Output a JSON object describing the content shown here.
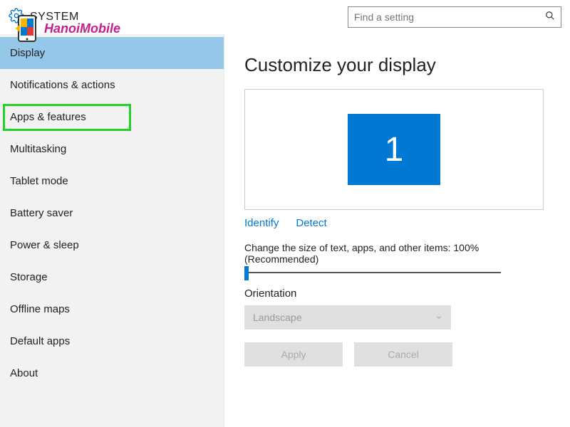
{
  "header": {
    "title": "SYSTEM",
    "search_placeholder": "Find a setting"
  },
  "sidebar": {
    "items": [
      {
        "label": "Display",
        "selected": true,
        "highlighted": false
      },
      {
        "label": "Notifications & actions",
        "selected": false,
        "highlighted": false
      },
      {
        "label": "Apps & features",
        "selected": false,
        "highlighted": true
      },
      {
        "label": "Multitasking",
        "selected": false,
        "highlighted": false
      },
      {
        "label": "Tablet mode",
        "selected": false,
        "highlighted": false
      },
      {
        "label": "Battery saver",
        "selected": false,
        "highlighted": false
      },
      {
        "label": "Power & sleep",
        "selected": false,
        "highlighted": false
      },
      {
        "label": "Storage",
        "selected": false,
        "highlighted": false
      },
      {
        "label": "Offline maps",
        "selected": false,
        "highlighted": false
      },
      {
        "label": "Default apps",
        "selected": false,
        "highlighted": false
      },
      {
        "label": "About",
        "selected": false,
        "highlighted": false
      }
    ]
  },
  "main": {
    "title": "Customize your display",
    "monitor_number": "1",
    "identify_link": "Identify",
    "detect_link": "Detect",
    "scale_label": "Change the size of text, apps, and other items: 100% (Recommended)",
    "orientation_label": "Orientation",
    "orientation_value": "Landscape",
    "apply_label": "Apply",
    "cancel_label": "Cancel"
  },
  "watermark": {
    "text": "HanoiMobile"
  }
}
